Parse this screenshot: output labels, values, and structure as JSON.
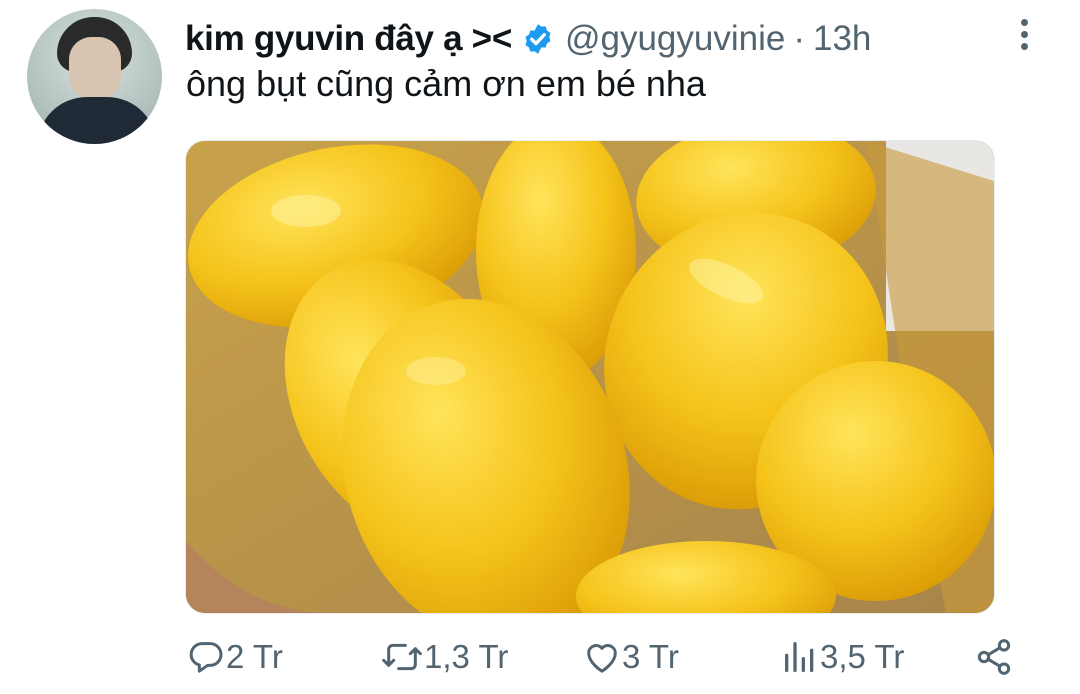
{
  "tweet": {
    "display_name": "kim gyuvin đây ạ ><",
    "handle": "@gyugyuvinie",
    "separator": "·",
    "time": "13h",
    "text": "ông bụt cũng cảm ơn em bé nha",
    "media_description_icon": "image-mangoes"
  },
  "actions": {
    "reply_count": "2 Tr",
    "retweet_count": "1,3 Tr",
    "like_count": "3 Tr",
    "views_count": "3,5 Tr"
  },
  "colors": {
    "verified_blue": "#1d9bf0",
    "secondary_text": "#536471",
    "primary_text": "#0f1419",
    "mango_yellow": "#f2c21b"
  }
}
